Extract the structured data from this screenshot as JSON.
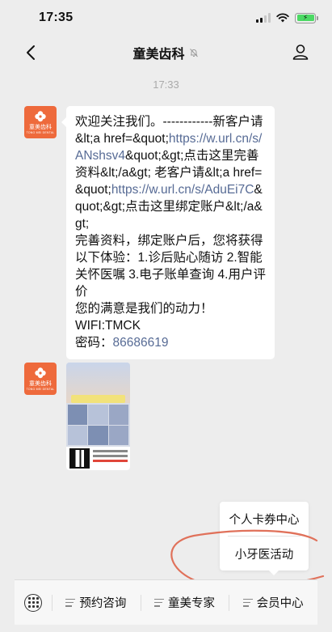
{
  "status_bar": {
    "time": "17:35"
  },
  "nav": {
    "title": "童美齿科",
    "icons": [
      "back-icon",
      "mute-bell-icon",
      "user-profile-icon"
    ]
  },
  "chat": {
    "timestamp": "17:33",
    "avatar": {
      "name_cn": "童美齿科",
      "name_en": "TONG MEI DENTAL",
      "color": "#ee6a3c"
    },
    "message": {
      "line1_prefix": "欢迎关注我们。------------新客户请&lt;a href=&quot;",
      "link1": "https://w.url.cn/s/ANshsv4",
      "line1_suffix": "&quot;&gt;点击这里完善资料&lt;/a&gt; 老客户请&lt;a href=&quot;",
      "link2": "https://w.url.cn/s/AduEi7C",
      "line2_suffix": "&quot;&gt;点击这里绑定账户&lt;/a&gt;",
      "para2": "完善资料，绑定账户后，您将获得以下体验：1.诊后贴心随访 2.智能关怀医嘱 3.电子账单查询 4.用户评价",
      "para3": "您的满意是我们的动力！",
      "wifi": "WIFI:TMCK",
      "password_label": "密码：",
      "password_value": "86686619"
    }
  },
  "popup_menu": {
    "items": [
      "个人卡券中心",
      "小牙医活动"
    ]
  },
  "bottom_menu": {
    "tabs": [
      "预约咨询",
      "童美专家",
      "会员中心"
    ]
  },
  "colors": {
    "link": "#576b95",
    "background": "#ededed",
    "annotation": "#e0715a"
  }
}
